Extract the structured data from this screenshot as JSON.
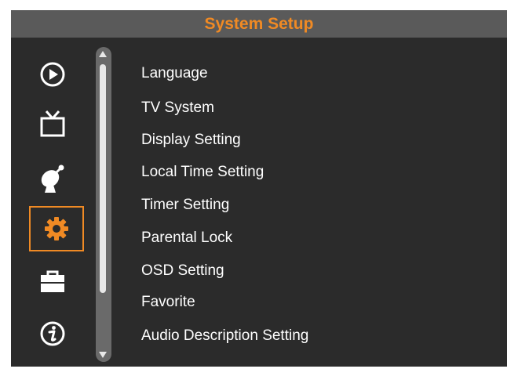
{
  "header": {
    "title": "System Setup"
  },
  "sidebar": {
    "items": [
      {
        "icon": "play-circle-icon",
        "selected": false
      },
      {
        "icon": "tv-icon",
        "selected": false
      },
      {
        "icon": "satellite-dish-icon",
        "selected": false
      },
      {
        "icon": "gear-icon",
        "selected": true
      },
      {
        "icon": "toolbox-icon",
        "selected": false
      },
      {
        "icon": "info-icon",
        "selected": false
      }
    ]
  },
  "menu": {
    "items": [
      {
        "label": "Language"
      },
      {
        "label": "TV System"
      },
      {
        "label": "Display Setting"
      },
      {
        "label": "Local Time Setting"
      },
      {
        "label": "Timer Setting"
      },
      {
        "label": "Parental Lock"
      },
      {
        "label": "OSD Setting"
      },
      {
        "label": "Favorite"
      },
      {
        "label": "Audio Description Setting"
      }
    ]
  },
  "colors": {
    "accent": "#f08a24",
    "panel": "#2b2b2b",
    "header": "#5a5a5a",
    "text": "#ffffff"
  }
}
